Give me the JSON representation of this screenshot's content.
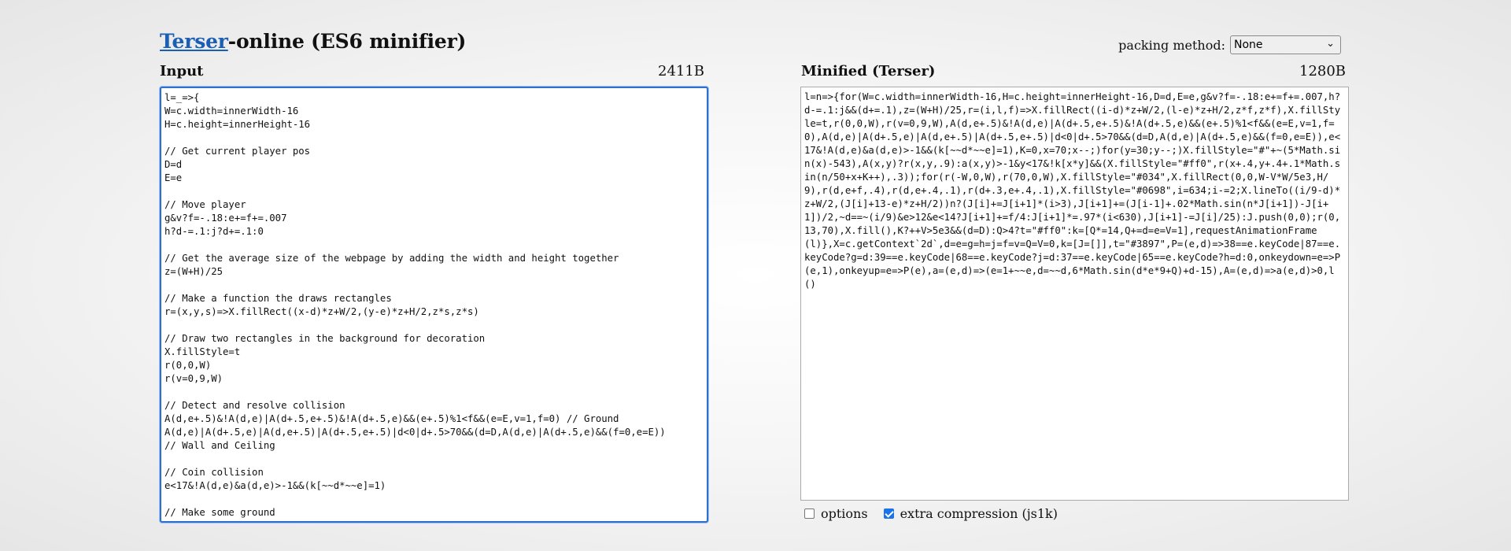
{
  "header": {
    "title_link": "Terser",
    "title_rest": "-online (ES6 minifier)",
    "packing_label": "packing method:",
    "packing_value": "None"
  },
  "input": {
    "label": "Input",
    "size": "2411B",
    "code": "l=_=>{\nW=c.width=innerWidth-16\nH=c.height=innerHeight-16\n\n// Get current player pos\nD=d\nE=e\n\n// Move player\ng&v?f=-.18:e+=f+=.007\nh?d-=.1:j?d+=.1:0\n\n// Get the average size of the webpage by adding the width and height together\nz=(W+H)/25\n\n// Make a function the draws rectangles\nr=(x,y,s)=>X.fillRect((x-d)*z+W/2,(y-e)*z+H/2,z*s,z*s)\n\n// Draw two rectangles in the background for decoration\nX.fillStyle=t\nr(0,0,W)\nr(v=0,9,W)\n\n// Detect and resolve collision\nA(d,e+.5)&!A(d,e)|A(d+.5,e+.5)&!A(d+.5,e)&&(e+.5)%1<f&&(e=E,v=1,f=0) // Ground\nA(d,e)|A(d+.5,e)|A(d,e+.5)|A(d+.5,e+.5)|d<0|d+.5>70&&(d=D,A(d,e)|A(d+.5,e)&&(f=0,e=E))\n// Wall and Ceiling\n\n// Coin collision\ne<17&!A(d,e)&a(d,e)>-1&&(k[~~d*~~e]=1)\n\n// Make some ground\n// Make a ground using a stepping mechanism and"
  },
  "output": {
    "label": "Minified (Terser)",
    "size": "1280B",
    "code": "l=n=>{for(W=c.width=innerWidth-16,H=c.height=innerHeight-16,D=d,E=e,g&v?f=-.18:e+=f+=.007,h?d-=.1:j&&(d+=.1),z=(W+H)/25,r=(i,l,f)=>X.fillRect((i-d)*z+W/2,(l-e)*z+H/2,z*f,z*f),X.fillStyle=t,r(0,0,W),r(v=0,9,W),A(d,e+.5)&!A(d,e)|A(d+.5,e+.5)&!A(d+.5,e)&&(e+.5)%1<f&&(e=E,v=1,f=0),A(d,e)|A(d+.5,e)|A(d,e+.5)|A(d+.5,e+.5)|d<0|d+.5>70&&(d=D,A(d,e)|A(d+.5,e)&&(f=0,e=E)),e<17&!A(d,e)&a(d,e)>-1&&(k[~~d*~~e]=1),K=0,x=70;x--;)for(y=30;y--;)X.fillStyle=\"#\"+~(5*Math.sin(x)-543),A(x,y)?r(x,y,.9):a(x,y)>-1&y<17&!k[x*y]&&(X.fillStyle=\"#ff0\",r(x+.4,y+.4+.1*Math.sin(n/50+x+K++),.3));for(r(-W,0,W),r(70,0,W),X.fillStyle=\"#034\",X.fillRect(0,0,W-V*W/5e3,H/9),r(d,e+f,.4),r(d,e+.4,.1),r(d+.3,e+.4,.1),X.fillStyle=\"#0698\",i=634;i-=2;X.lineTo((i/9-d)*z+W/2,(J[i]+13-e)*z+H/2))n?(J[i]+=J[i+1]*(i>3),J[i+1]+=(J[i-1]+.02*Math.sin(n*J[i+1])-J[i+1])/2,~d==~(i/9)&e>12&e<14?J[i+1]+=f/4:J[i+1]*=.97*(i<630),J[i+1]-=J[i]/25):J.push(0,0);r(0,13,70),X.fill(),K?++V>5e3&&(d=D):Q>4?t=\"#ff0\":k=[Q*=14,Q+=d=e=V=1],requestAnimationFrame(l)},X=c.getContext`2d`,d=e=g=h=j=f=v=Q=V=0,k=[J=[]],t=\"#3897\",P=(e,d)=>38==e.keyCode|87==e.keyCode?g=d:39==e.keyCode|68==e.keyCode?j=d:37==e.keyCode|65==e.keyCode?h=d:0,onkeydown=e=>P(e,1),onkeyup=e=>P(e),a=(e,d)=>(e=1+~~e,d=~~d,6*Math.sin(d*e*9+Q)+d-15),A=(e,d)=>a(e,d)>0,l()"
  },
  "options": {
    "options_label": "options",
    "options_checked": false,
    "extra_label": "extra compression (js1k)",
    "extra_checked": true
  }
}
